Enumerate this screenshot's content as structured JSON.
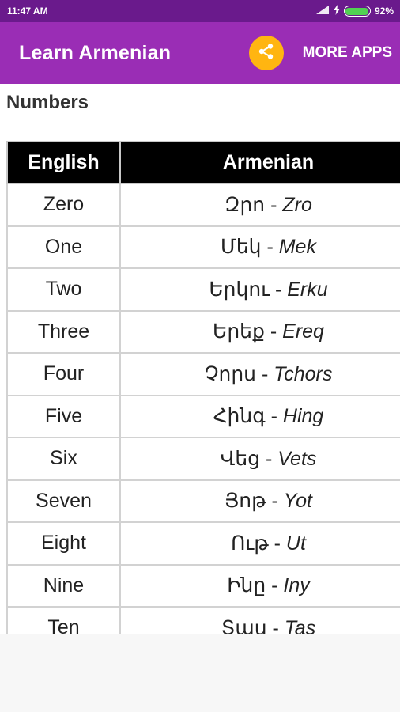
{
  "status_bar": {
    "time": "11:47 AM",
    "battery": "92%"
  },
  "app_bar": {
    "title": "Learn Armenian",
    "more_apps": "MORE APPS"
  },
  "section": {
    "title": "Numbers"
  },
  "table": {
    "headers": [
      "English",
      "Armenian"
    ],
    "rows": [
      {
        "english": "Zero",
        "armenian": "Զրո",
        "translit": "Zro"
      },
      {
        "english": "One",
        "armenian": "Մեկ",
        "translit": "Mek"
      },
      {
        "english": "Two",
        "armenian": "Երկու",
        "translit": "Erku"
      },
      {
        "english": "Three",
        "armenian": "Երեք",
        "translit": "Ereq"
      },
      {
        "english": "Four",
        "armenian": "Չորս",
        "translit": "Tchors"
      },
      {
        "english": "Five",
        "armenian": "Հինգ",
        "translit": "Hing"
      },
      {
        "english": "Six",
        "armenian": "Վեց",
        "translit": "Vets"
      },
      {
        "english": "Seven",
        "armenian": "Յոթ",
        "translit": "Yot"
      },
      {
        "english": "Eight",
        "armenian": "Ութ",
        "translit": "Ut"
      },
      {
        "english": "Nine",
        "armenian": "Ինը",
        "translit": "Iny"
      },
      {
        "english": "Ten",
        "armenian": "Տաս",
        "translit": "Tas"
      }
    ]
  },
  "colors": {
    "status_bar": "#6a1a8c",
    "app_bar": "#9a2db5",
    "share_button": "#ffb511",
    "battery": "#52d053"
  }
}
